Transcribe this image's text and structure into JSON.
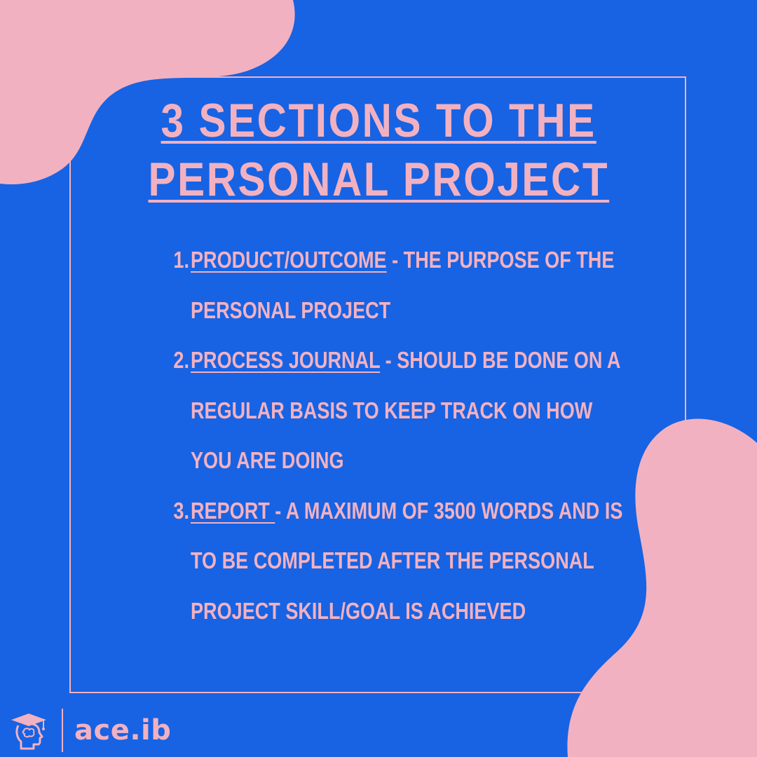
{
  "colors": {
    "background": "#1763e3",
    "accent": "#f2b1c1"
  },
  "title": {
    "line1": "3 SECTIONS TO THE",
    "line2": "PERSONAL PROJECT"
  },
  "sections": [
    {
      "number": "1.",
      "term": "PRODUCT/OUTCOME",
      "description": " - THE PURPOSE OF THE PERSONAL PROJECT"
    },
    {
      "number": "2.",
      "term": "PROCESS JOURNAL",
      "description": " - SHOULD BE DONE ON A REGULAR BASIS TO KEEP TRACK ON HOW YOU ARE DOING"
    },
    {
      "number": "3.",
      "term": "REPORT ",
      "description": "- A MAXIMUM OF 3500 WORDS AND IS TO BE COMPLETED AFTER THE PERSONAL PROJECT SKILL/GOAL IS ACHIEVED"
    }
  ],
  "footer": {
    "logo_icon": "graduate-head-icon",
    "brand": "ace.ib"
  }
}
